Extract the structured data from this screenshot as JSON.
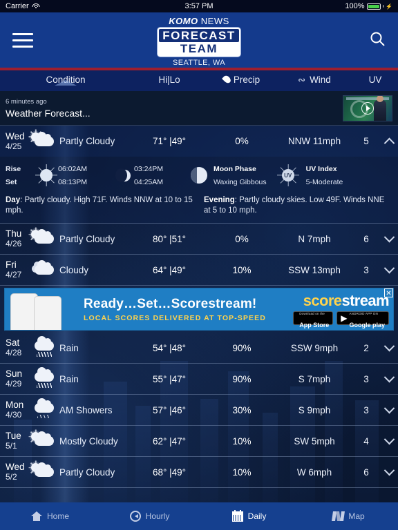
{
  "status_bar": {
    "carrier": "Carrier",
    "wifi_icon": "wifi-icon",
    "time": "3:57 PM",
    "battery_percent": "100%",
    "battery_icon": "battery-charging-icon"
  },
  "navbar": {
    "menu_icon": "hamburger-menu-icon",
    "search_icon": "search-icon",
    "brand_komo": "KOMO",
    "brand_news": "NEWS",
    "brand_forecast": "FORECAST",
    "brand_team": "TEAM",
    "location": "SEATTLE, WA"
  },
  "columns": {
    "condition": "Condition",
    "hilo": "Hi|Lo",
    "precip": "Precip",
    "precip_icon": "water-droplet-icon",
    "wind": "Wind",
    "wind_icon": "wind-icon",
    "uv": "UV",
    "active": "Condition"
  },
  "video": {
    "timestamp": "6 minutes ago",
    "title": "Weather Forecast...",
    "play_icon": "play-button-icon",
    "thumbnail_icon": "video-thumbnail"
  },
  "forecast": [
    {
      "day": "Wed",
      "date": "4/25",
      "condition": "Partly Cloudy",
      "icon": "partly-cloudy-icon",
      "hilo": "71° |49°",
      "precip": "0%",
      "wind": "NNW 11mph",
      "uv": "5",
      "expanded": true
    },
    {
      "day": "Thu",
      "date": "4/26",
      "condition": "Partly Cloudy",
      "icon": "partly-cloudy-icon",
      "hilo": "80° |51°",
      "precip": "0%",
      "wind": "N 7mph",
      "uv": "6",
      "expanded": false
    },
    {
      "day": "Fri",
      "date": "4/27",
      "condition": "Cloudy",
      "icon": "cloudy-icon",
      "hilo": "64° |49°",
      "precip": "10%",
      "wind": "SSW 13mph",
      "uv": "3",
      "expanded": false
    },
    {
      "day": "Sat",
      "date": "4/28",
      "condition": "Rain",
      "icon": "rain-icon",
      "hilo": "54° |48°",
      "precip": "90%",
      "wind": "SSW 9mph",
      "uv": "2",
      "expanded": false
    },
    {
      "day": "Sun",
      "date": "4/29",
      "condition": "Rain",
      "icon": "rain-icon",
      "hilo": "55° |47°",
      "precip": "90%",
      "wind": "S 7mph",
      "uv": "3",
      "expanded": false
    },
    {
      "day": "Mon",
      "date": "4/30",
      "condition": "AM Showers",
      "icon": "showers-icon",
      "hilo": "57° |46°",
      "precip": "30%",
      "wind": "S 9mph",
      "uv": "3",
      "expanded": false
    },
    {
      "day": "Tue",
      "date": "5/1",
      "condition": "Mostly Cloudy",
      "icon": "mostly-cloudy-icon",
      "hilo": "62° |47°",
      "precip": "10%",
      "wind": "SW 5mph",
      "uv": "4",
      "expanded": false
    },
    {
      "day": "Wed",
      "date": "5/2",
      "condition": "Partly Cloudy",
      "icon": "partly-cloudy-icon",
      "hilo": "68° |49°",
      "precip": "10%",
      "wind": "W 6mph",
      "uv": "6",
      "expanded": false
    }
  ],
  "detail": {
    "rise_label": "Rise",
    "set_label": "Set",
    "sun_rise": "06:02AM",
    "sun_set": "08:13PM",
    "moon_rise": "03:24PM",
    "moon_set": "04:25AM",
    "sun_icon": "sun-icon",
    "moon_icon": "crescent-moon-icon",
    "moon_phase_label": "Moon Phase",
    "moon_phase_value": "Waxing Gibbous",
    "moon_phase_icon": "moon-phase-icon",
    "uv_label": "UV Index",
    "uv_value": "5-Moderate",
    "uv_icon": "uv-sun-icon",
    "uv_badge_text": "UV",
    "day_label": "Day",
    "day_text": ": Partly cloudy. High 71F. Winds NNW at 10 to 15 mph.",
    "evening_label": "Evening",
    "evening_text": ": Partly cloudy skies. Low 49F. Winds NNE at 5 to 10 mph."
  },
  "ad": {
    "headline": "Ready…Set…Scorestream!",
    "subhead": "LOCAL SCORES DELIVERED AT TOP-SPEED",
    "logo_score": "score",
    "logo_stream": "stream",
    "appstore_top": "Download on the",
    "appstore_bottom": "App Store",
    "appstore_icon": "apple-icon",
    "googleplay_top": "ANDROID APP ON",
    "googleplay_bottom": "Google play",
    "googleplay_icon": "play-triangle-icon",
    "close_label": "✕",
    "close_icon": "close-icon"
  },
  "tabs": [
    {
      "label": "Home",
      "icon": "home-icon",
      "active": false
    },
    {
      "label": "Hourly",
      "icon": "clock-icon",
      "active": false
    },
    {
      "label": "Daily",
      "icon": "calendar-icon",
      "active": true
    },
    {
      "label": "Map",
      "icon": "map-icon",
      "active": false
    }
  ],
  "colors": {
    "navbar": "#143a8c",
    "accent_red": "#9e1f2f",
    "background": "#0a1430",
    "tabbar": "#15408f",
    "ad_blue": "#1f7ec4",
    "ad_yellow": "#ffd34d"
  }
}
